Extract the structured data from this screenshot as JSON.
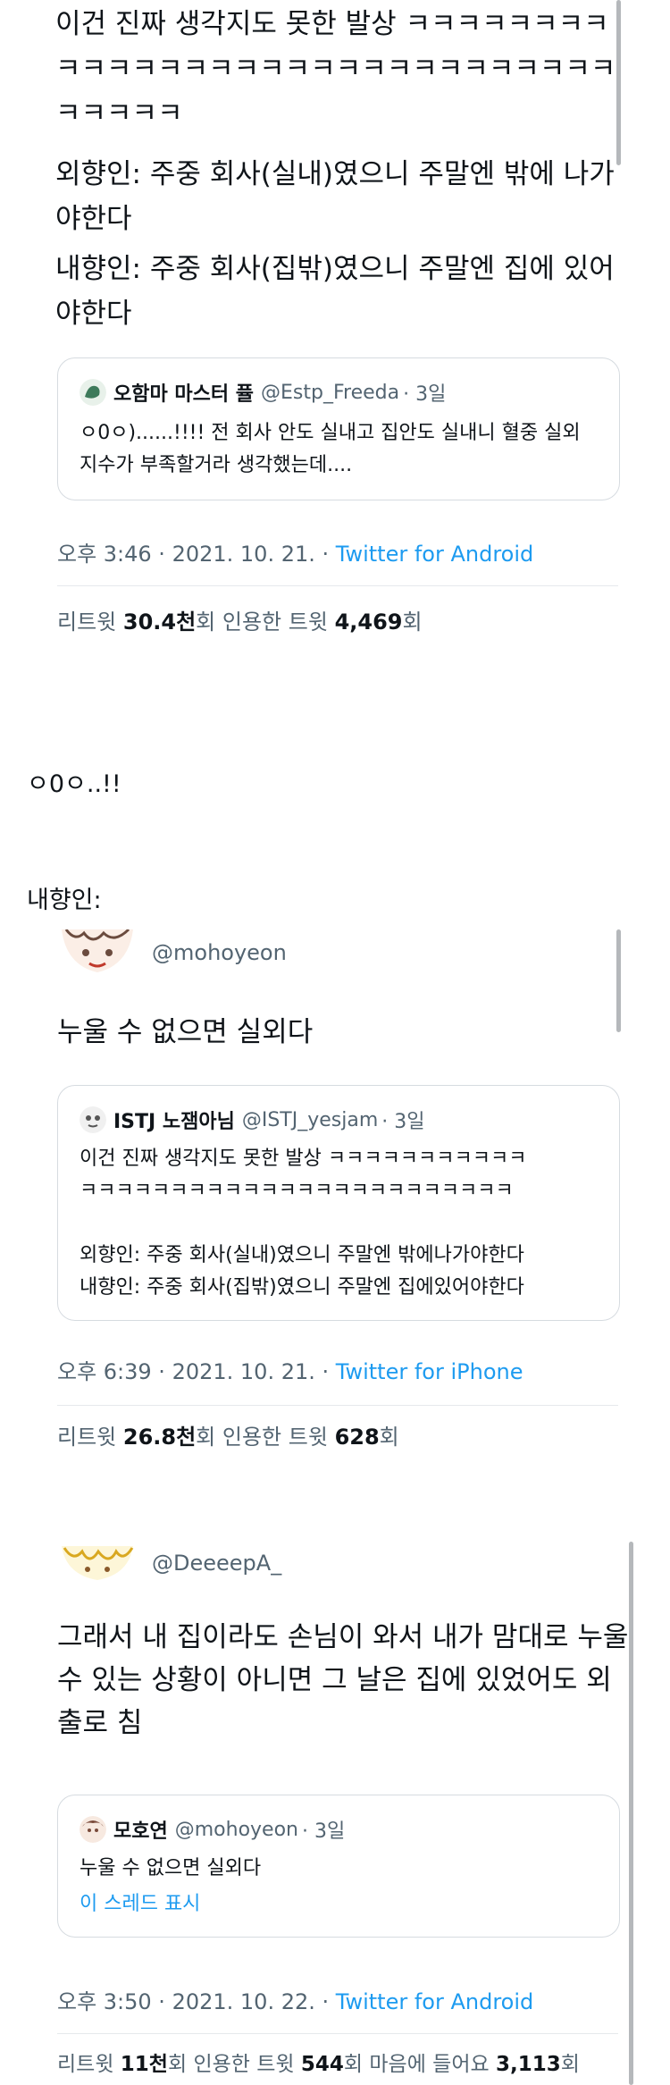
{
  "tweet1": {
    "body": "이건 진짜 생각지도 못한 발상 ㅋㅋㅋㅋㅋㅋㅋㅋㅋㅋㅋㅋㅋㅋㅋㅋㅋㅋㅋㅋㅋㅋㅋㅋㅋㅋㅋㅋㅋㅋㅋㅋㅋㅋㅋ",
    "body2": "외향인: 주중 회사(실내)였으니 주말엔 밖에 나가야한다",
    "body3": "내향인: 주중 회사(집밖)였으니 주말엔 집에 있어야한다",
    "quote": {
      "name": "오함마 마스터 퓰",
      "handle": "@Estp_Freeda",
      "time": "· 3일",
      "body": "ㅇ0ㅇ)......!!!! 전 회사 안도 실내고 집안도 실내니 혈중 실외지수가 부족할거라 생각했는데...."
    },
    "meta_time": "오후 3:46 · 2021. 10. 21. · ",
    "meta_source": "Twitter for Android",
    "stats": {
      "retweet_label": "리트윗 ",
      "retweet_value": "30.4천",
      "retweet_suffix": "회  ",
      "quote_label": "인용한 트윗 ",
      "quote_value": "4,469",
      "quote_suffix": "회"
    }
  },
  "interlude1": "ㅇ0ㅇ..!!",
  "interlude2": "내향인:",
  "tweet2": {
    "handle": "@mohoyeon",
    "body": "누울 수 없으면 실외다",
    "quote": {
      "name": "ISTJ 노잼아님",
      "handle": "@ISTJ_yesjam",
      "time": "· 3일",
      "line1": "이건 진짜 생각지도 못한 발상 ㅋㅋㅋㅋㅋㅋㅋㅋㅋㅋㅋ",
      "line2": "ㅋㅋㅋㅋㅋㅋㅋㅋㅋㅋㅋㅋㅋㅋㅋㅋㅋㅋㅋㅋㅋㅋㅋㅋ",
      "line3": "외향인: 주중 회사(실내)였으니 주말엔 밖에나가야한다",
      "line4": "내향인: 주중 회사(집밖)였으니 주말엔 집에있어야한다"
    },
    "meta_time": "오후 6:39 · 2021. 10. 21. · ",
    "meta_source": "Twitter for iPhone",
    "stats": {
      "retweet_label": "리트윗 ",
      "retweet_value": "26.8천",
      "retweet_suffix": "회  ",
      "quote_label": "인용한 트윗 ",
      "quote_value": "628",
      "quote_suffix": "회"
    }
  },
  "tweet3": {
    "handle": "@DeeeepA_",
    "body": "그래서 내 집이라도 손님이 와서 내가 맘대로 누울 수 있는 상황이 아니면 그 날은 집에 있었어도 외출로 침",
    "quote": {
      "name": "모호연",
      "handle": "@mohoyeon",
      "time": "· 3일",
      "body": "누울 수 없으면 실외다",
      "thread_link": "이 스레드 표시"
    },
    "meta_time": "오후 3:50 · 2021. 10. 22. · ",
    "meta_source": "Twitter for Android",
    "stats": {
      "retweet_label": "리트윗 ",
      "retweet_value": "11천",
      "retweet_suffix": "회  ",
      "quote_label": "인용한 트윗 ",
      "quote_value": "544",
      "quote_suffix": "회  ",
      "like_label": "마음에 들어요 ",
      "like_value": "3,113",
      "like_suffix": "회"
    }
  },
  "colors": {
    "accent": "#1d9bf0",
    "muted": "#536471",
    "border": "#d6dbe0",
    "text": "#0f1419"
  }
}
